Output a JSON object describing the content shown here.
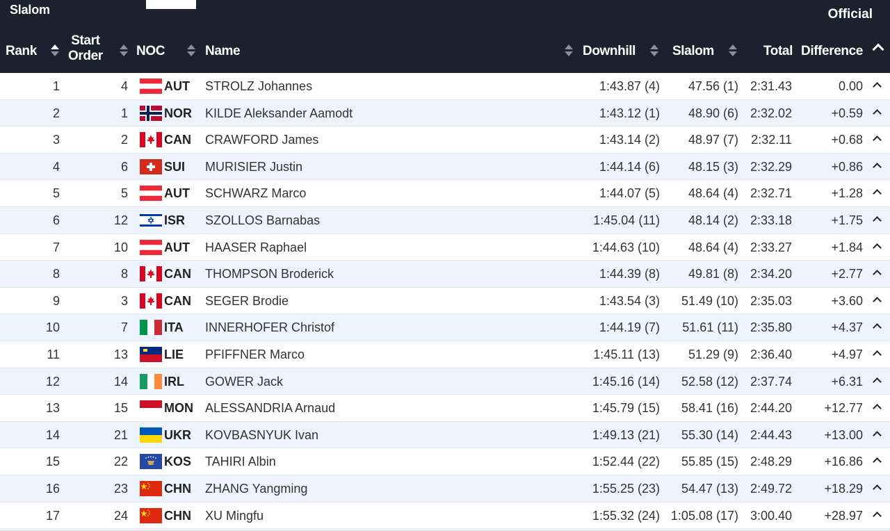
{
  "event": {
    "title": "Slalom",
    "status": "Official"
  },
  "columns": {
    "rank": "Rank",
    "start_order_line1": "Start",
    "start_order_line2": "Order",
    "noc": "NOC",
    "name": "Name",
    "downhill": "Downhill",
    "slalom": "Slalom",
    "total": "Total",
    "difference": "Difference"
  },
  "rows": [
    {
      "rank": "1",
      "start": "4",
      "noc": "AUT",
      "name": "STROLZ Johannes",
      "downhill": "1:43.87 (4)",
      "slalom": "47.56 (1)",
      "total": "2:31.43",
      "diff": "0.00",
      "flag": "aut-flag-icon"
    },
    {
      "rank": "2",
      "start": "1",
      "noc": "NOR",
      "name": "KILDE Aleksander Aamodt",
      "downhill": "1:43.12 (1)",
      "slalom": "48.90 (6)",
      "total": "2:32.02",
      "diff": "+0.59",
      "flag": "nor-flag-icon"
    },
    {
      "rank": "3",
      "start": "2",
      "noc": "CAN",
      "name": "CRAWFORD James",
      "downhill": "1:43.14 (2)",
      "slalom": "48.97 (7)",
      "total": "2:32.11",
      "diff": "+0.68",
      "flag": "can-flag-icon"
    },
    {
      "rank": "4",
      "start": "6",
      "noc": "SUI",
      "name": "MURISIER Justin",
      "downhill": "1:44.14 (6)",
      "slalom": "48.15 (3)",
      "total": "2:32.29",
      "diff": "+0.86",
      "flag": "sui-flag-icon"
    },
    {
      "rank": "5",
      "start": "5",
      "noc": "AUT",
      "name": "SCHWARZ Marco",
      "downhill": "1:44.07 (5)",
      "slalom": "48.64 (4)",
      "total": "2:32.71",
      "diff": "+1.28",
      "flag": "aut-flag-icon"
    },
    {
      "rank": "6",
      "start": "12",
      "noc": "ISR",
      "name": "SZOLLOS Barnabas",
      "downhill": "1:45.04 (11)",
      "slalom": "48.14 (2)",
      "total": "2:33.18",
      "diff": "+1.75",
      "flag": "isr-flag-icon"
    },
    {
      "rank": "7",
      "start": "10",
      "noc": "AUT",
      "name": "HAASER Raphael",
      "downhill": "1:44.63 (10)",
      "slalom": "48.64 (4)",
      "total": "2:33.27",
      "diff": "+1.84",
      "flag": "aut-flag-icon"
    },
    {
      "rank": "8",
      "start": "8",
      "noc": "CAN",
      "name": "THOMPSON Broderick",
      "downhill": "1:44.39 (8)",
      "slalom": "49.81 (8)",
      "total": "2:34.20",
      "diff": "+2.77",
      "flag": "can-flag-icon"
    },
    {
      "rank": "9",
      "start": "3",
      "noc": "CAN",
      "name": "SEGER Brodie",
      "downhill": "1:43.54 (3)",
      "slalom": "51.49 (10)",
      "total": "2:35.03",
      "diff": "+3.60",
      "flag": "can-flag-icon"
    },
    {
      "rank": "10",
      "start": "7",
      "noc": "ITA",
      "name": "INNERHOFER Christof",
      "downhill": "1:44.19 (7)",
      "slalom": "51.61 (11)",
      "total": "2:35.80",
      "diff": "+4.37",
      "flag": "ita-flag-icon"
    },
    {
      "rank": "11",
      "start": "13",
      "noc": "LIE",
      "name": "PFIFFNER Marco",
      "downhill": "1:45.11 (13)",
      "slalom": "51.29 (9)",
      "total": "2:36.40",
      "diff": "+4.97",
      "flag": "lie-flag-icon"
    },
    {
      "rank": "12",
      "start": "14",
      "noc": "IRL",
      "name": "GOWER Jack",
      "downhill": "1:45.16 (14)",
      "slalom": "52.58 (12)",
      "total": "2:37.74",
      "diff": "+6.31",
      "flag": "irl-flag-icon"
    },
    {
      "rank": "13",
      "start": "15",
      "noc": "MON",
      "name": "ALESSANDRIA Arnaud",
      "downhill": "1:45.79 (15)",
      "slalom": "58.41 (16)",
      "total": "2:44.20",
      "diff": "+12.77",
      "flag": "mon-flag-icon"
    },
    {
      "rank": "14",
      "start": "21",
      "noc": "UKR",
      "name": "KOVBASNYUK Ivan",
      "downhill": "1:49.13 (21)",
      "slalom": "55.30 (14)",
      "total": "2:44.43",
      "diff": "+13.00",
      "flag": "ukr-flag-icon"
    },
    {
      "rank": "15",
      "start": "22",
      "noc": "KOS",
      "name": "TAHIRI Albin",
      "downhill": "1:52.44 (22)",
      "slalom": "55.85 (15)",
      "total": "2:48.29",
      "diff": "+16.86",
      "flag": "kos-flag-icon"
    },
    {
      "rank": "16",
      "start": "23",
      "noc": "CHN",
      "name": "ZHANG Yangming",
      "downhill": "1:55.25 (23)",
      "slalom": "54.47 (13)",
      "total": "2:49.72",
      "diff": "+18.29",
      "flag": "chn-flag-icon"
    },
    {
      "rank": "17",
      "start": "24",
      "noc": "CHN",
      "name": "XU Mingfu",
      "downhill": "1:55.32 (24)",
      "slalom": "1:05.08 (17)",
      "total": "3:00.40",
      "diff": "+28.97",
      "flag": "chn-flag-icon"
    }
  ]
}
